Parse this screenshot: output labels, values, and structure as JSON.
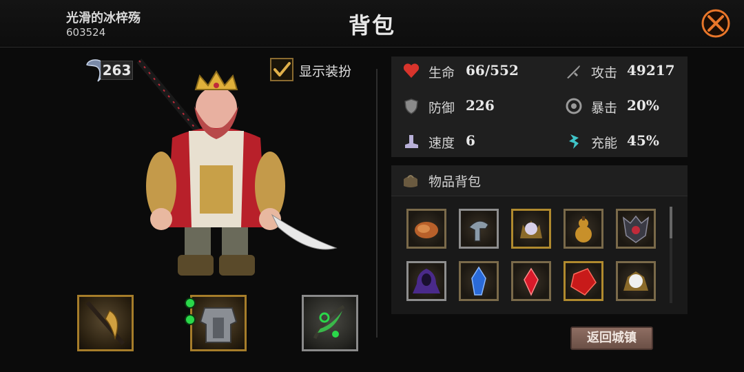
{
  "header": {
    "player_name": "光滑的冰梓殇",
    "player_id": "603524",
    "title": "背包"
  },
  "left": {
    "gem_count": "263",
    "show_outfit_label": "显示装扮",
    "show_outfit_checked": true
  },
  "stats": [
    {
      "label": "生命",
      "value": "66/552",
      "icon": "heart-icon",
      "color": "#d8342c"
    },
    {
      "label": "攻击",
      "value": "49217",
      "icon": "sword-icon",
      "color": "#9a9a9a"
    },
    {
      "label": "防御",
      "value": "226",
      "icon": "shield-icon",
      "color": "#9a9a9a"
    },
    {
      "label": "暴击",
      "value": "20%",
      "icon": "crit-icon",
      "color": "#9a9a9a"
    },
    {
      "label": "速度",
      "value": "6",
      "icon": "boot-icon",
      "color": "#b8b0d8"
    },
    {
      "label": "充能",
      "value": "45%",
      "icon": "energy-icon",
      "color": "#3fc4c8"
    }
  ],
  "inventory": {
    "title": "物品背包",
    "items": [
      {
        "name": "meat-item",
        "frame": "bronze"
      },
      {
        "name": "helmet-item",
        "frame": "silver"
      },
      {
        "name": "orb-crown-item",
        "frame": "gold"
      },
      {
        "name": "gourd-item",
        "frame": "bronze"
      },
      {
        "name": "spiked-mask-item",
        "frame": "bronze"
      },
      {
        "name": "purple-cloak-item",
        "frame": "silver"
      },
      {
        "name": "blue-crystal-item",
        "frame": "bronze"
      },
      {
        "name": "red-crystal-item",
        "frame": "bronze"
      },
      {
        "name": "red-gem-item",
        "frame": "gold"
      },
      {
        "name": "white-orb-item",
        "frame": "bronze"
      }
    ]
  },
  "back_button_label": "返回城镇",
  "colors": {
    "accent_gold": "#a67d2a",
    "close_orange": "#e8762a"
  }
}
